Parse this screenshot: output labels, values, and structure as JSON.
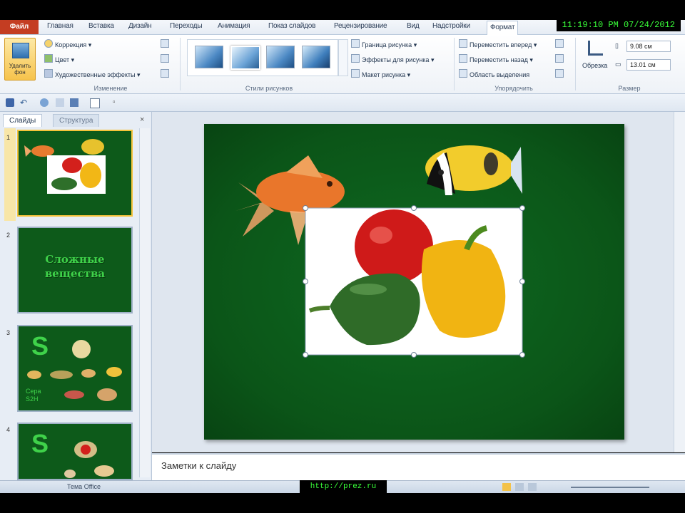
{
  "ribbon_tabs": [
    "Главная",
    "Вставка",
    "Дизайн",
    "Переходы",
    "Анимация",
    "Показ слайдов",
    "Рецензирование",
    "Вид",
    "Надстройки",
    "Формат"
  ],
  "file_tab": "Файл",
  "clock": "11:19:10 PM 07/24/2012",
  "ribbon": {
    "remove_bg": "Удалить фон",
    "adjust": [
      "Коррекция",
      "Цвет",
      "Художественные эффекты"
    ],
    "adjust_group": "Изменение",
    "styles_group": "Стили рисунков",
    "picture_opts": [
      "Граница рисунка",
      "Эффекты для рисунка",
      "Макет рисунка"
    ],
    "arrange": [
      "Переместить вперед",
      "Переместить назад",
      "Область выделения"
    ],
    "arrange_group": "Упорядочить",
    "crop": "Обрезка",
    "height": "9.08 см",
    "width": "13.01 см",
    "size_group": "Размер"
  },
  "panel_tabs": {
    "slides": "Слайды",
    "outline": "Структура"
  },
  "slides": [
    {
      "num": "1"
    },
    {
      "num": "2",
      "title": "Сложные вещества"
    },
    {
      "num": "3",
      "letter": "S",
      "extra": "Сера S2H"
    },
    {
      "num": "4",
      "letter": "S"
    }
  ],
  "notes_placeholder": "Заметки к слайду",
  "status": {
    "theme": "Тема Office",
    "url": "http://prez.ru"
  },
  "colors": {
    "slide_bg": "#0b5518",
    "file_tab": "#c43d22",
    "clock_text": "#39ff39",
    "selection": "#f5c33a"
  },
  "icons": [
    "fish-goldfish",
    "fish-butterfly",
    "pepper-red",
    "pepper-yellow",
    "pepper-green"
  ]
}
